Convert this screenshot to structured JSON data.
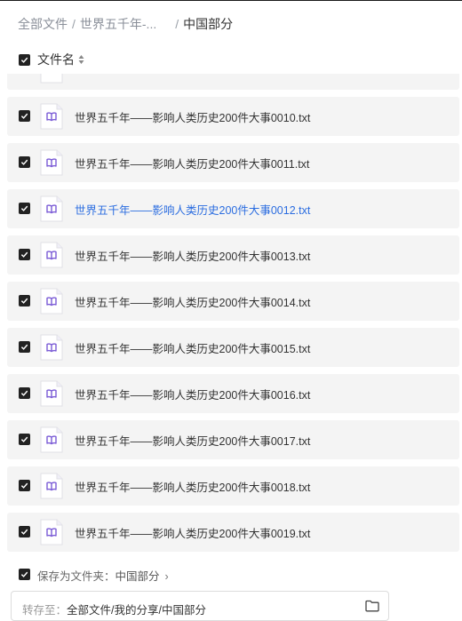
{
  "breadcrumb": {
    "root": "全部文件",
    "parent": "世界五千年-...",
    "separator": "/",
    "current": "中国部分"
  },
  "header": {
    "column_label": "文件名",
    "select_all_checked": true
  },
  "files": [
    {
      "name": "世界五千年——影响人类历史200件大事0010.txt",
      "checked": true
    },
    {
      "name": "世界五千年——影响人类历史200件大事0011.txt",
      "checked": true
    },
    {
      "name": "世界五千年——影响人类历史200件大事0012.txt",
      "checked": true,
      "highlighted": true
    },
    {
      "name": "世界五千年——影响人类历史200件大事0013.txt",
      "checked": true
    },
    {
      "name": "世界五千年——影响人类历史200件大事0014.txt",
      "checked": true
    },
    {
      "name": "世界五千年——影响人类历史200件大事0015.txt",
      "checked": true
    },
    {
      "name": "世界五千年——影响人类历史200件大事0016.txt",
      "checked": true
    },
    {
      "name": "世界五千年——影响人类历史200件大事0017.txt",
      "checked": true
    },
    {
      "name": "世界五千年——影响人类历史200件大事0018.txt",
      "checked": true
    },
    {
      "name": "世界五千年——影响人类历史200件大事0019.txt",
      "checked": true
    }
  ],
  "save_as": {
    "label": "保存为文件夹：",
    "folder": "中国部分",
    "checked": true
  },
  "transfer": {
    "prefix": "转存至：",
    "path": "全部文件/我的分享/中国部分"
  },
  "colors": {
    "checkbox": "#222222",
    "row_bg": "#f4f4f4",
    "link": "#2b6de0",
    "icon_accent": "#7b5cd6"
  },
  "icons": {
    "sort": "sort-icon",
    "file": "book-file-icon",
    "folder": "folder-icon",
    "chevron": "chevron-right-icon",
    "check": "check-icon"
  }
}
